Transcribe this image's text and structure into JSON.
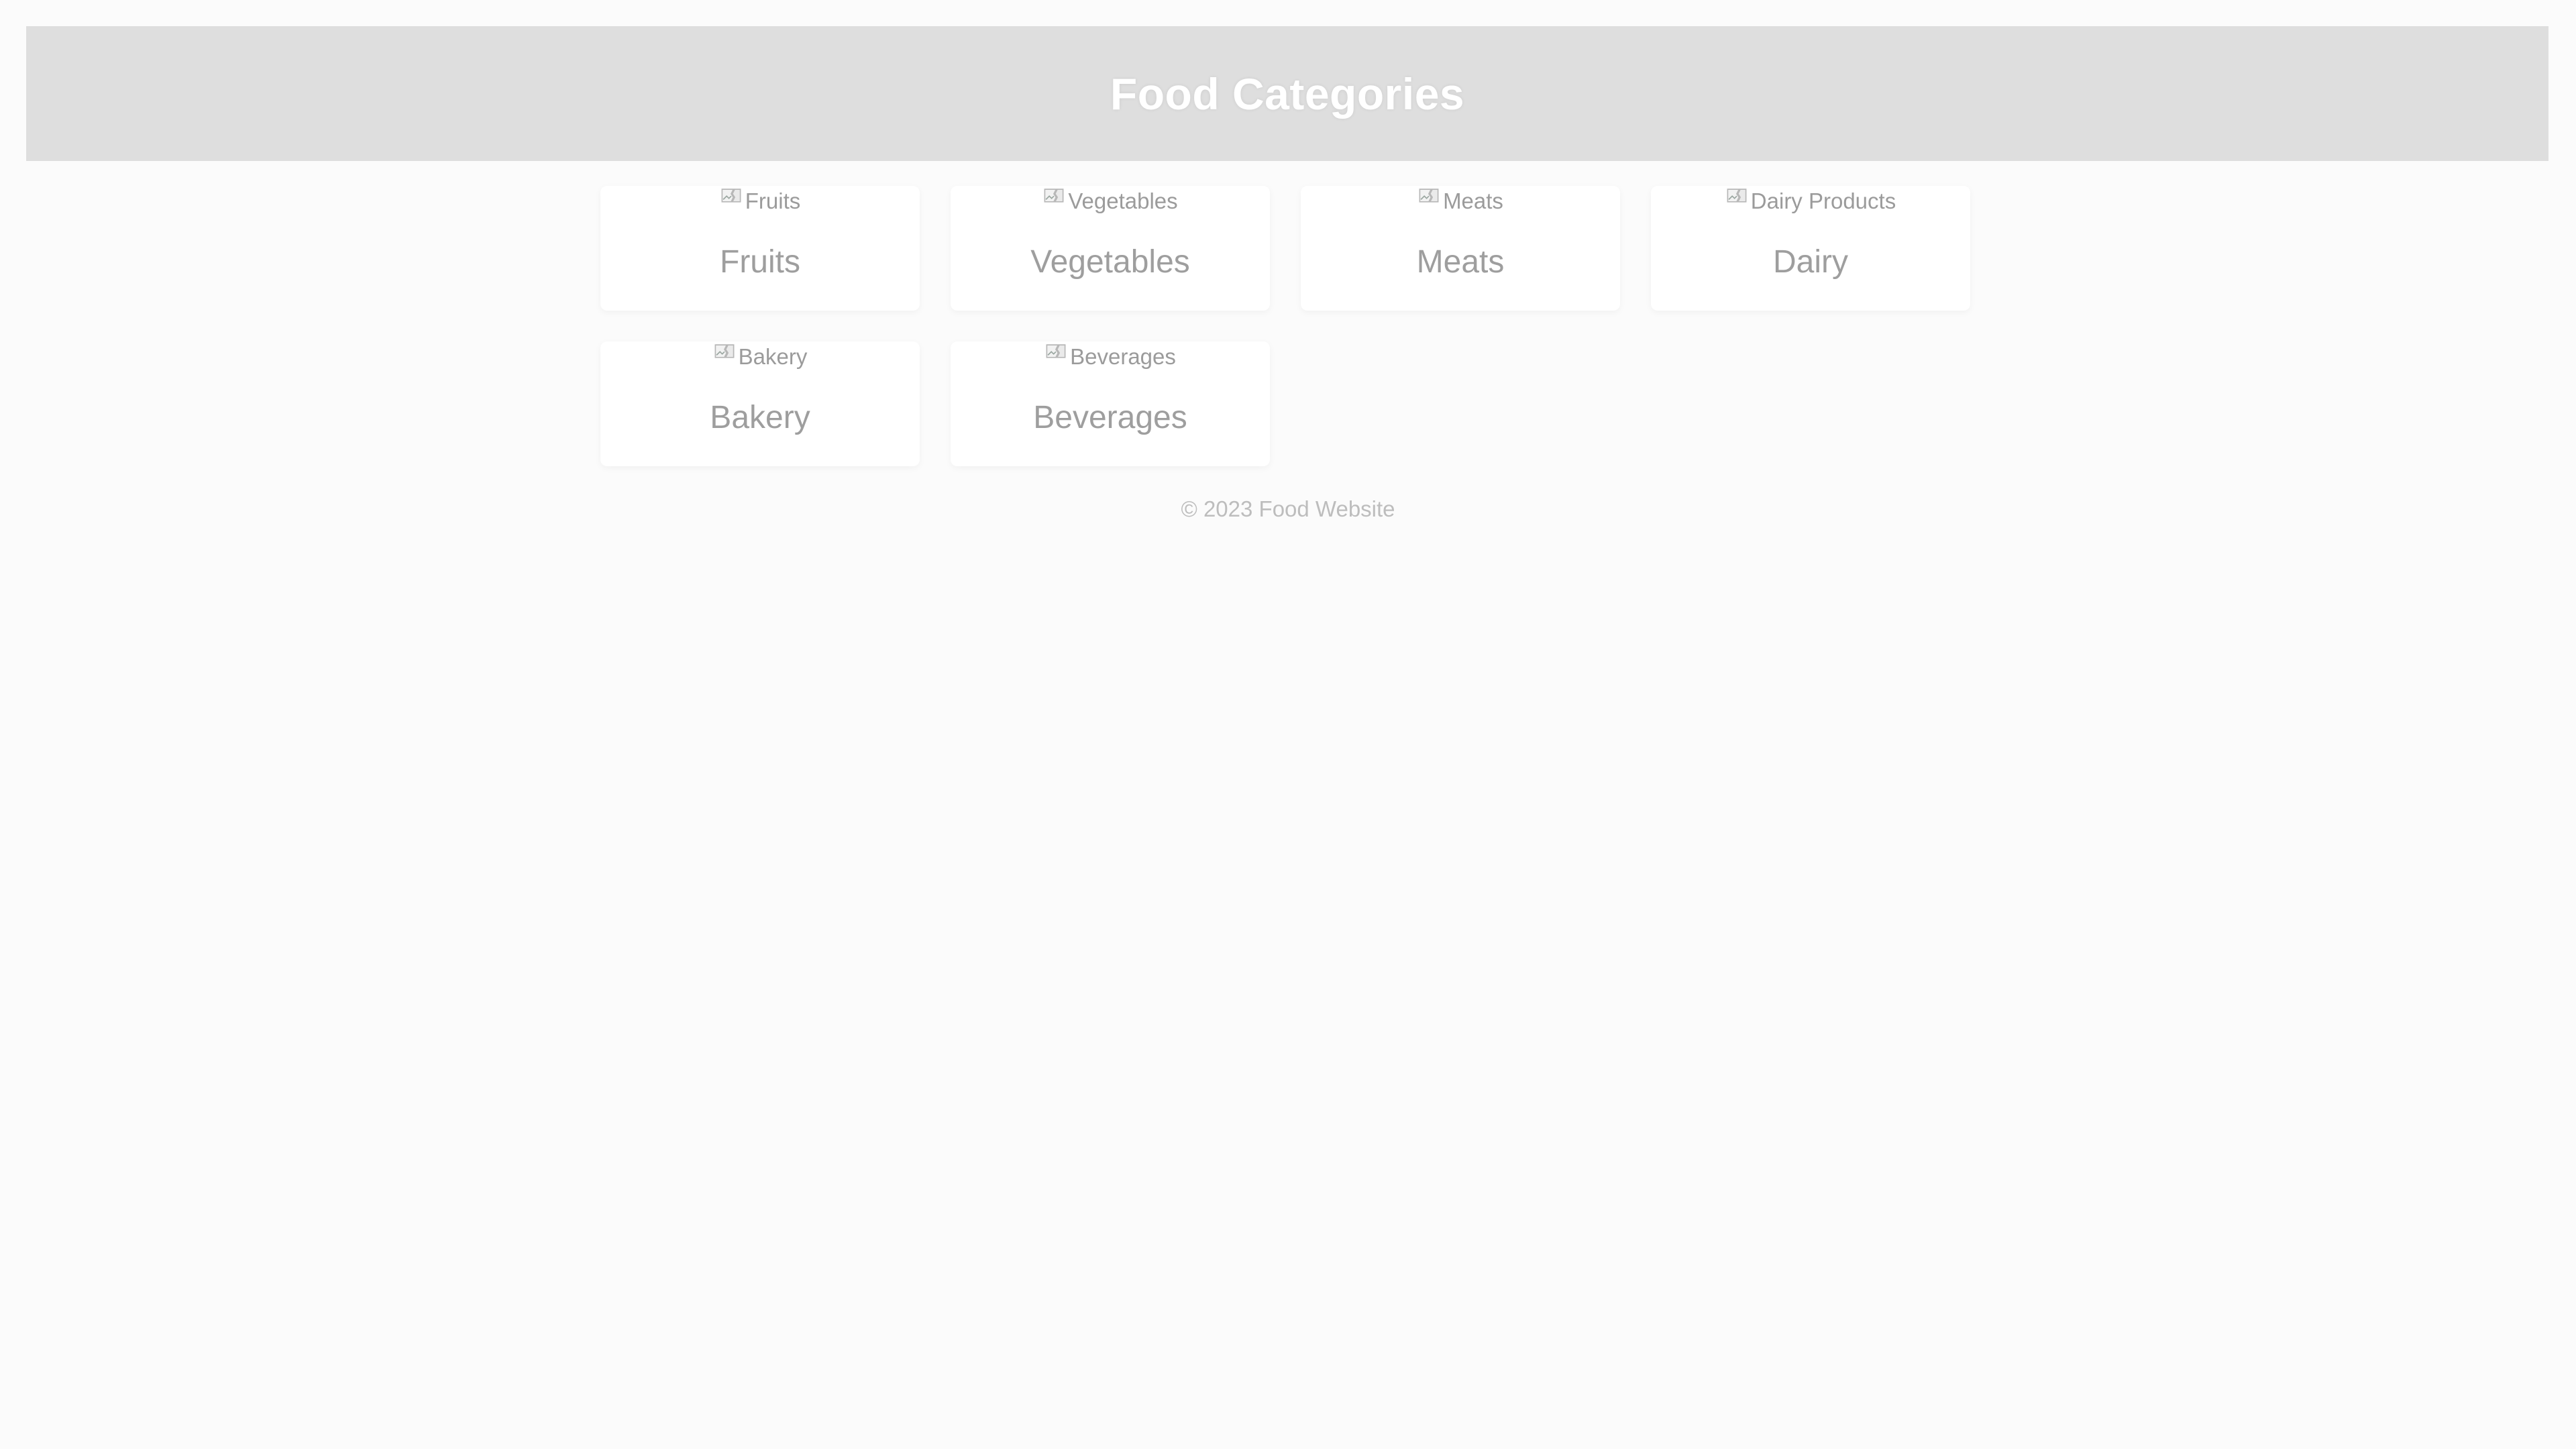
{
  "header": {
    "title": "Food Categories"
  },
  "categories": [
    {
      "image_alt": "Fruits",
      "title": "Fruits"
    },
    {
      "image_alt": "Vegetables",
      "title": "Vegetables"
    },
    {
      "image_alt": "Meats",
      "title": "Meats"
    },
    {
      "image_alt": "Dairy Products",
      "title": "Dairy"
    },
    {
      "image_alt": "Bakery",
      "title": "Bakery"
    },
    {
      "image_alt": "Beverages",
      "title": "Beverages"
    }
  ],
  "footer": {
    "text": "© 2023 Food Website"
  },
  "icons": {
    "image": "broken-image-icon"
  }
}
